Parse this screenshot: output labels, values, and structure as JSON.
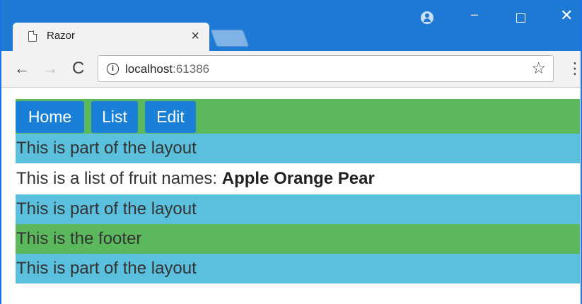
{
  "browser": {
    "tab_title": "Razor",
    "tab_close": "×",
    "url_host": "localhost",
    "url_port": ":61386",
    "info_glyph": "i"
  },
  "window_controls": {
    "minimize": "–",
    "close": "✕"
  },
  "toolbar": {
    "back": "←",
    "forward": "→",
    "reload": "C",
    "star": "☆",
    "menu": "⋮"
  },
  "nav": {
    "home": "Home",
    "list": "List",
    "edit": "Edit"
  },
  "page": {
    "layout_text": "This is part of the layout",
    "fruit_prefix": "This is a list of fruit names:",
    "fruits": "Apple Orange Pear",
    "footer_text": "This is the footer"
  },
  "colors": {
    "nav_bar": "#5cb85c",
    "nav_button": "#1a7fd6",
    "layout_row": "#5bc0de",
    "footer_row": "#5cb85c",
    "titlebar": "#1f7ad6"
  }
}
